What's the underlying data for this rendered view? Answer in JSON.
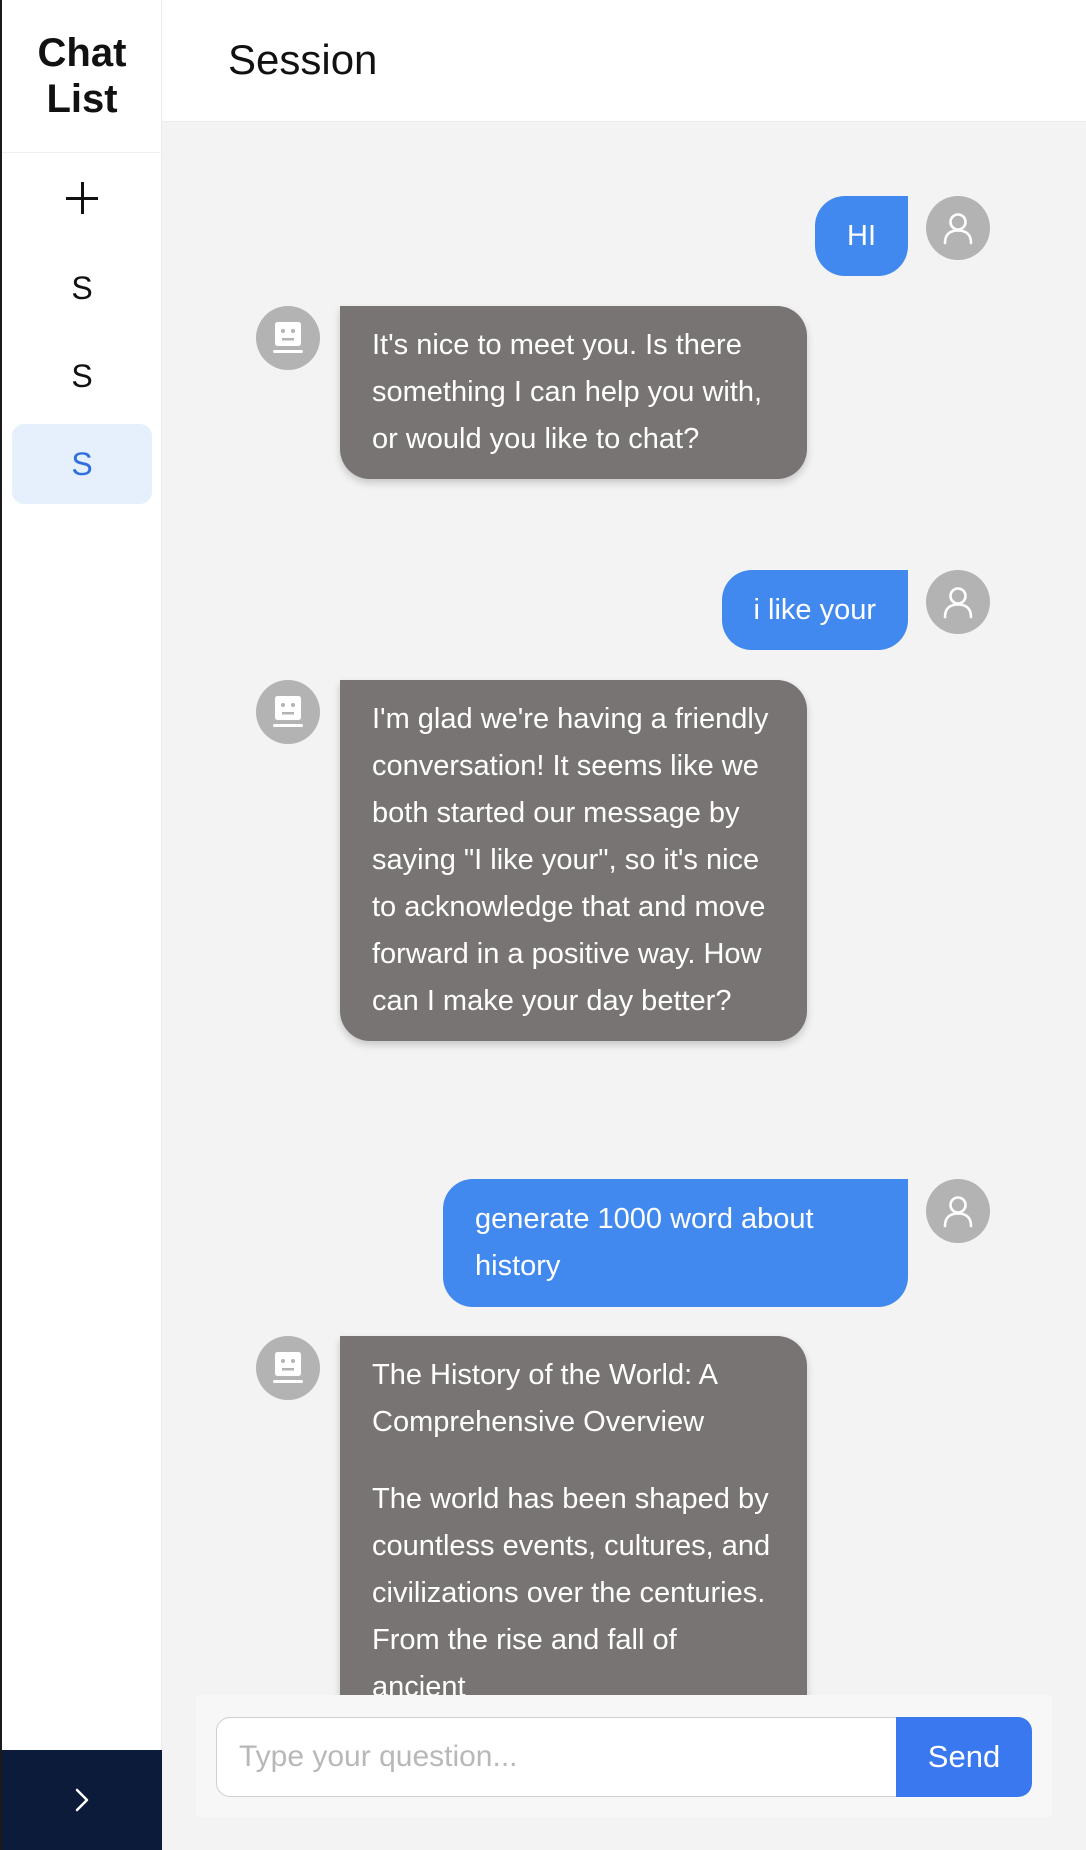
{
  "sidebar": {
    "title": "Chat\nList",
    "new_chat_icon": "plus-icon",
    "items": [
      {
        "label": "S",
        "active": false
      },
      {
        "label": "S",
        "active": false
      },
      {
        "label": "S",
        "active": true
      }
    ],
    "toggle_icon": "chevron-right-icon"
  },
  "header": {
    "title": "Session"
  },
  "messages": [
    {
      "role": "user",
      "text": "HI"
    },
    {
      "role": "bot",
      "paragraphs": [
        "It's nice to meet you. Is there something I can help you with, or would you like to chat?"
      ]
    },
    {
      "role": "user",
      "text": "i like your"
    },
    {
      "role": "bot",
      "paragraphs": [
        "I'm glad we're having a friendly conversation! It seems like we both started our message by saying \"I like your\", so it's nice to acknowledge that and move forward in a positive way. How can I make your day better?"
      ]
    },
    {
      "role": "user",
      "text": "generate 1000 word about history"
    },
    {
      "role": "bot",
      "paragraphs": [
        "The History of the World: A Comprehensive Overview",
        "The world has been shaped by countless events, cultures, and civilizations over the centuries. From the rise and fall of ancient"
      ]
    }
  ],
  "input": {
    "placeholder": "Type your question...",
    "value": "",
    "send_label": "Send"
  },
  "colors": {
    "user_bubble": "#4189ef",
    "bot_bubble": "#787473",
    "send_button": "#3a78f0",
    "active_item_bg": "#e6f0fd",
    "active_item_text": "#2f6fe0",
    "sidebar_footer": "#0d1b3a",
    "avatar": "#b3b3b3"
  }
}
